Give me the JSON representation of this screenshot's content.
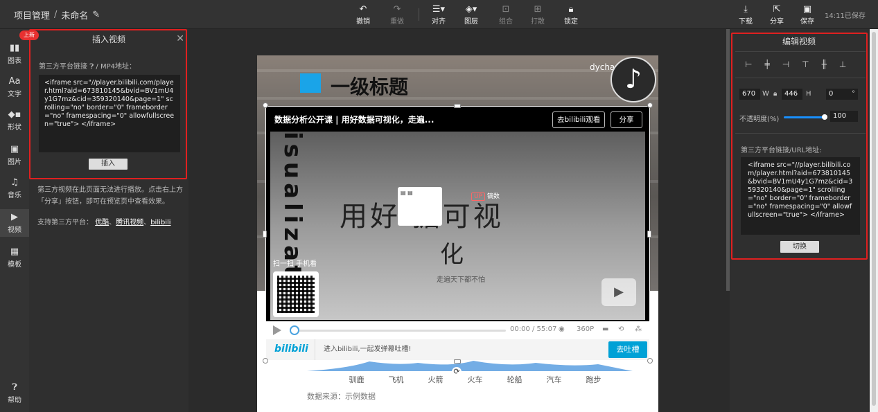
{
  "breadcrumb": {
    "project": "项目管理",
    "sep": "/",
    "name": "未命名"
  },
  "toolbar": {
    "undo": "撤销",
    "redo": "重做",
    "align": "对齐",
    "layer": "图层",
    "group": "组合",
    "ungroup": "打散",
    "lock": "锁定",
    "download": "下载",
    "share": "分享",
    "save": "保存",
    "saved_status": "14:11已保存"
  },
  "nav": [
    "图表",
    "文字",
    "形状",
    "图片",
    "音乐",
    "视频",
    "模板",
    "帮助"
  ],
  "insert_panel": {
    "badge": "上新",
    "title": "插入视频",
    "label": "第三方平台链接",
    "label_tail": "/ MP4地址：",
    "code": "<iframe src=\"//player.bilibili.com/player.html?aid=673810145&bvid=BV1mU4y1G7mz&cid=359320140&page=1\" scrolling=\"no\" border=\"0\" frameborder=\"no\" framespacing=\"0\" allowfullscreen=\"true\"> </iframe>",
    "button": "插入",
    "note": "第三方视频在此页面无法进行播放。点击右上方「分享」按钮，即可在预览页中查看效果。",
    "support_label": "支持第三方平台：",
    "platforms": [
      "优酷",
      "腾讯视频",
      "bilibili"
    ],
    "sep": "、"
  },
  "slide": {
    "title": "一级标题",
    "logo": "dycharts.com",
    "categories": [
      "驯鹿",
      "飞机",
      "火箭",
      "火车",
      "轮船",
      "汽车",
      "跑步"
    ],
    "source": "数据来源：示例数据"
  },
  "video": {
    "title": "数据分析公开课 | 用好数据可视化，走遍...",
    "goto_bilibili": "去bilibili观看",
    "share": "分享",
    "big_text_1": "用好   据可视",
    "big_text_2": "化",
    "small_text": "走遍天下都不怕",
    "vertical_text": "isualizati",
    "up_label": "UP",
    "up_name": "镝数",
    "scan_text": "扫一扫 手机看",
    "time": "00:00 / 55:07",
    "resolution": "360P",
    "logo": "bilibili",
    "danmu_placeholder": "进入bilibili,一起发弹幕吐槽!",
    "send": "去吐槽"
  },
  "edit_panel": {
    "title": "编辑视频",
    "width": "670",
    "width_unit": "W",
    "height": "446",
    "height_unit": "H",
    "rotation": "0",
    "rotation_unit": "°",
    "opacity_label": "不透明度(%)",
    "opacity": "100",
    "url_label": "第三方平台链接/URL地址:",
    "code": "<iframe src=\"//player.bilibili.com/player.html?aid=673810145&bvid=BV1mU4y1G7mz&cid=359320140&page=1\" scrolling=\"no\" border=\"0\" frameborder=\"no\" framespacing=\"0\" allowfullscreen=\"true\"> </iframe>",
    "button": "切换"
  },
  "colors": {
    "accent": "#1aa4e8",
    "highlight": "#e02020",
    "bilibili": "#00a1d6"
  }
}
